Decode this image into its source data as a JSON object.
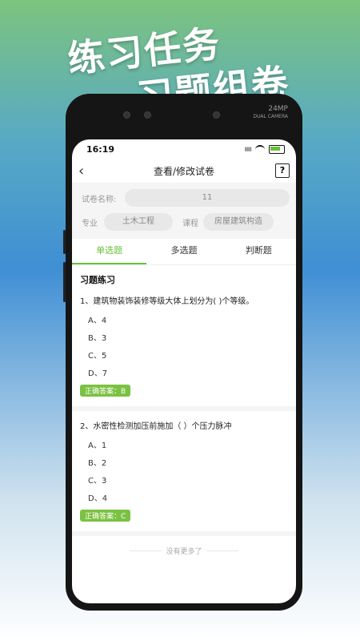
{
  "promo": {
    "line1": "练习任务",
    "line2": "习题组卷"
  },
  "phone": {
    "camera_label_1": "24MP",
    "camera_label_2": "DUAL CAMERA"
  },
  "status_bar": {
    "time": "16:19"
  },
  "nav": {
    "title": "查看/修改试卷",
    "help": "?"
  },
  "form": {
    "name_label": "试卷名称:",
    "name_value": "11",
    "major_label": "专业",
    "major_value": "土木工程",
    "course_label": "课程",
    "course_value": "房屋建筑构造"
  },
  "tabs": [
    {
      "label": "单选题",
      "active": true
    },
    {
      "label": "多选题",
      "active": false
    },
    {
      "label": "判断题",
      "active": false
    }
  ],
  "section_title": "习题练习",
  "questions": [
    {
      "text": "1、建筑物装饰装修等级大体上划分为(    )个等级。",
      "options": [
        "A、4",
        "B、3",
        "C、5",
        "D、7"
      ],
      "answer": "正确答案：B"
    },
    {
      "text": "2、水密性检测加压前施加（ ）个压力脉冲",
      "options": [
        "A、1",
        "B、2",
        "C、3",
        "D、4"
      ],
      "answer": "正确答案：C"
    }
  ],
  "footer": "没有更多了",
  "colors": {
    "accent": "#6abf3a",
    "answer_badge": "#7bc142"
  }
}
